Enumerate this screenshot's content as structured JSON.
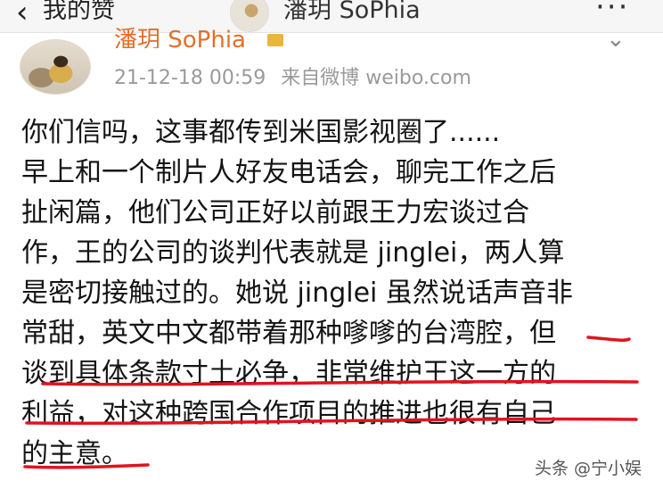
{
  "header": {
    "back_label": "我的赞",
    "account_name": "潘玥 SoPhia"
  },
  "post": {
    "author": "潘玥 SoPhia",
    "timestamp": "21-12-18 00:59",
    "source": "来自微博 weibo.com",
    "lines": [
      "你们信吗，这事都传到米国影视圈了......",
      "早上和一个制片人好友电话会，聊完工作之后",
      "扯闲篇，他们公司正好以前跟王力宏谈过合",
      "作，王的公司的谈判代表就是 jinglei，两人算",
      "是密切接触过的。她说 jinglei 虽然说话声音非",
      "常甜，英文中文都带着那种嗲嗲的台湾腔，但",
      "谈到具体条款寸土必争，非常维护王这一方的",
      "利益，对这种跨国合作项目的推进也很有自己",
      "的主意。"
    ]
  },
  "watermark": "头条 @宁小娱",
  "colors": {
    "author": "#e2702a",
    "underline": "#e0141e"
  }
}
